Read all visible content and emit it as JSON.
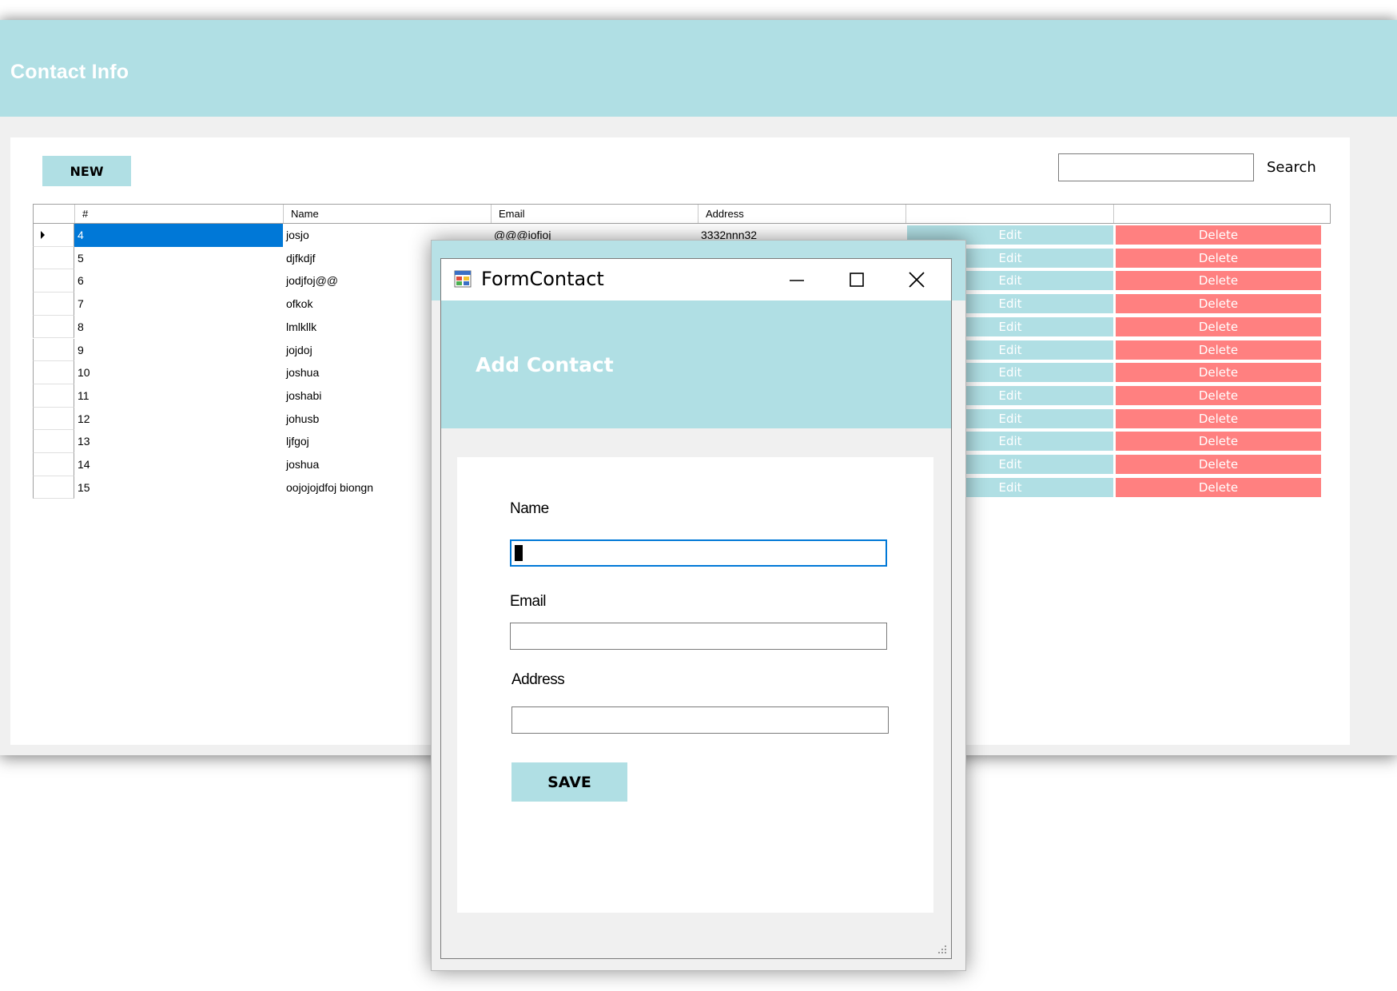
{
  "main": {
    "title": "Contact Info",
    "new_label": "NEW",
    "search_label": "Search",
    "search_value": "",
    "columns": [
      "#",
      "Name",
      "Email",
      "Address",
      "",
      ""
    ],
    "rows": [
      {
        "id": "4",
        "name": "josjo",
        "email": "@@@iofioj",
        "address": "3332nnn32",
        "edit": "Edit",
        "delete": "Delete"
      },
      {
        "id": "5",
        "name": "djfkdjf",
        "email": "",
        "address": "",
        "edit": "Edit",
        "delete": "Delete"
      },
      {
        "id": "6",
        "name": "jodjfoj@@",
        "email": "",
        "address": "",
        "edit": "Edit",
        "delete": "Delete"
      },
      {
        "id": "7",
        "name": "ofkok",
        "email": "",
        "address": "",
        "edit": "Edit",
        "delete": "Delete"
      },
      {
        "id": "8",
        "name": "lmlkllk",
        "email": "",
        "address": "",
        "edit": "Edit",
        "delete": "Delete"
      },
      {
        "id": "9",
        "name": "jojdoj",
        "email": "",
        "address": "",
        "edit": "Edit",
        "delete": "Delete"
      },
      {
        "id": "10",
        "name": "joshua",
        "email": "",
        "address": "",
        "edit": "Edit",
        "delete": "Delete"
      },
      {
        "id": "11",
        "name": "joshabi",
        "email": "",
        "address": "",
        "edit": "Edit",
        "delete": "Delete"
      },
      {
        "id": "12",
        "name": "johusb",
        "email": "",
        "address": "",
        "edit": "Edit",
        "delete": "Delete"
      },
      {
        "id": "13",
        "name": "ljfgoj",
        "email": "",
        "address": "",
        "edit": "Edit",
        "delete": "Delete"
      },
      {
        "id": "14",
        "name": "joshua",
        "email": "",
        "address": "",
        "edit": "Edit",
        "delete": "Delete"
      },
      {
        "id": "15",
        "name": "oojojojdfoj biongn",
        "email": "",
        "address": "",
        "edit": "Edit",
        "delete": "Delete"
      }
    ]
  },
  "dialog": {
    "window_title": "FormContact",
    "header": "Add Contact",
    "name_label": "Name",
    "name_value": "",
    "email_label": "Email",
    "email_value": "",
    "address_label": "Address",
    "address_value": "",
    "save_label": "SAVE"
  },
  "colors": {
    "accent": "#b0dfe4",
    "delete": "#ff8080",
    "selection": "#0078d7",
    "background": "#f0f0f0"
  },
  "icons": {
    "app": "form-app-icon",
    "minimize": "minimize-icon",
    "maximize": "maximize-icon",
    "close": "close-icon",
    "row_pointer": "row-pointer-icon",
    "resize": "resize-grip-icon"
  }
}
